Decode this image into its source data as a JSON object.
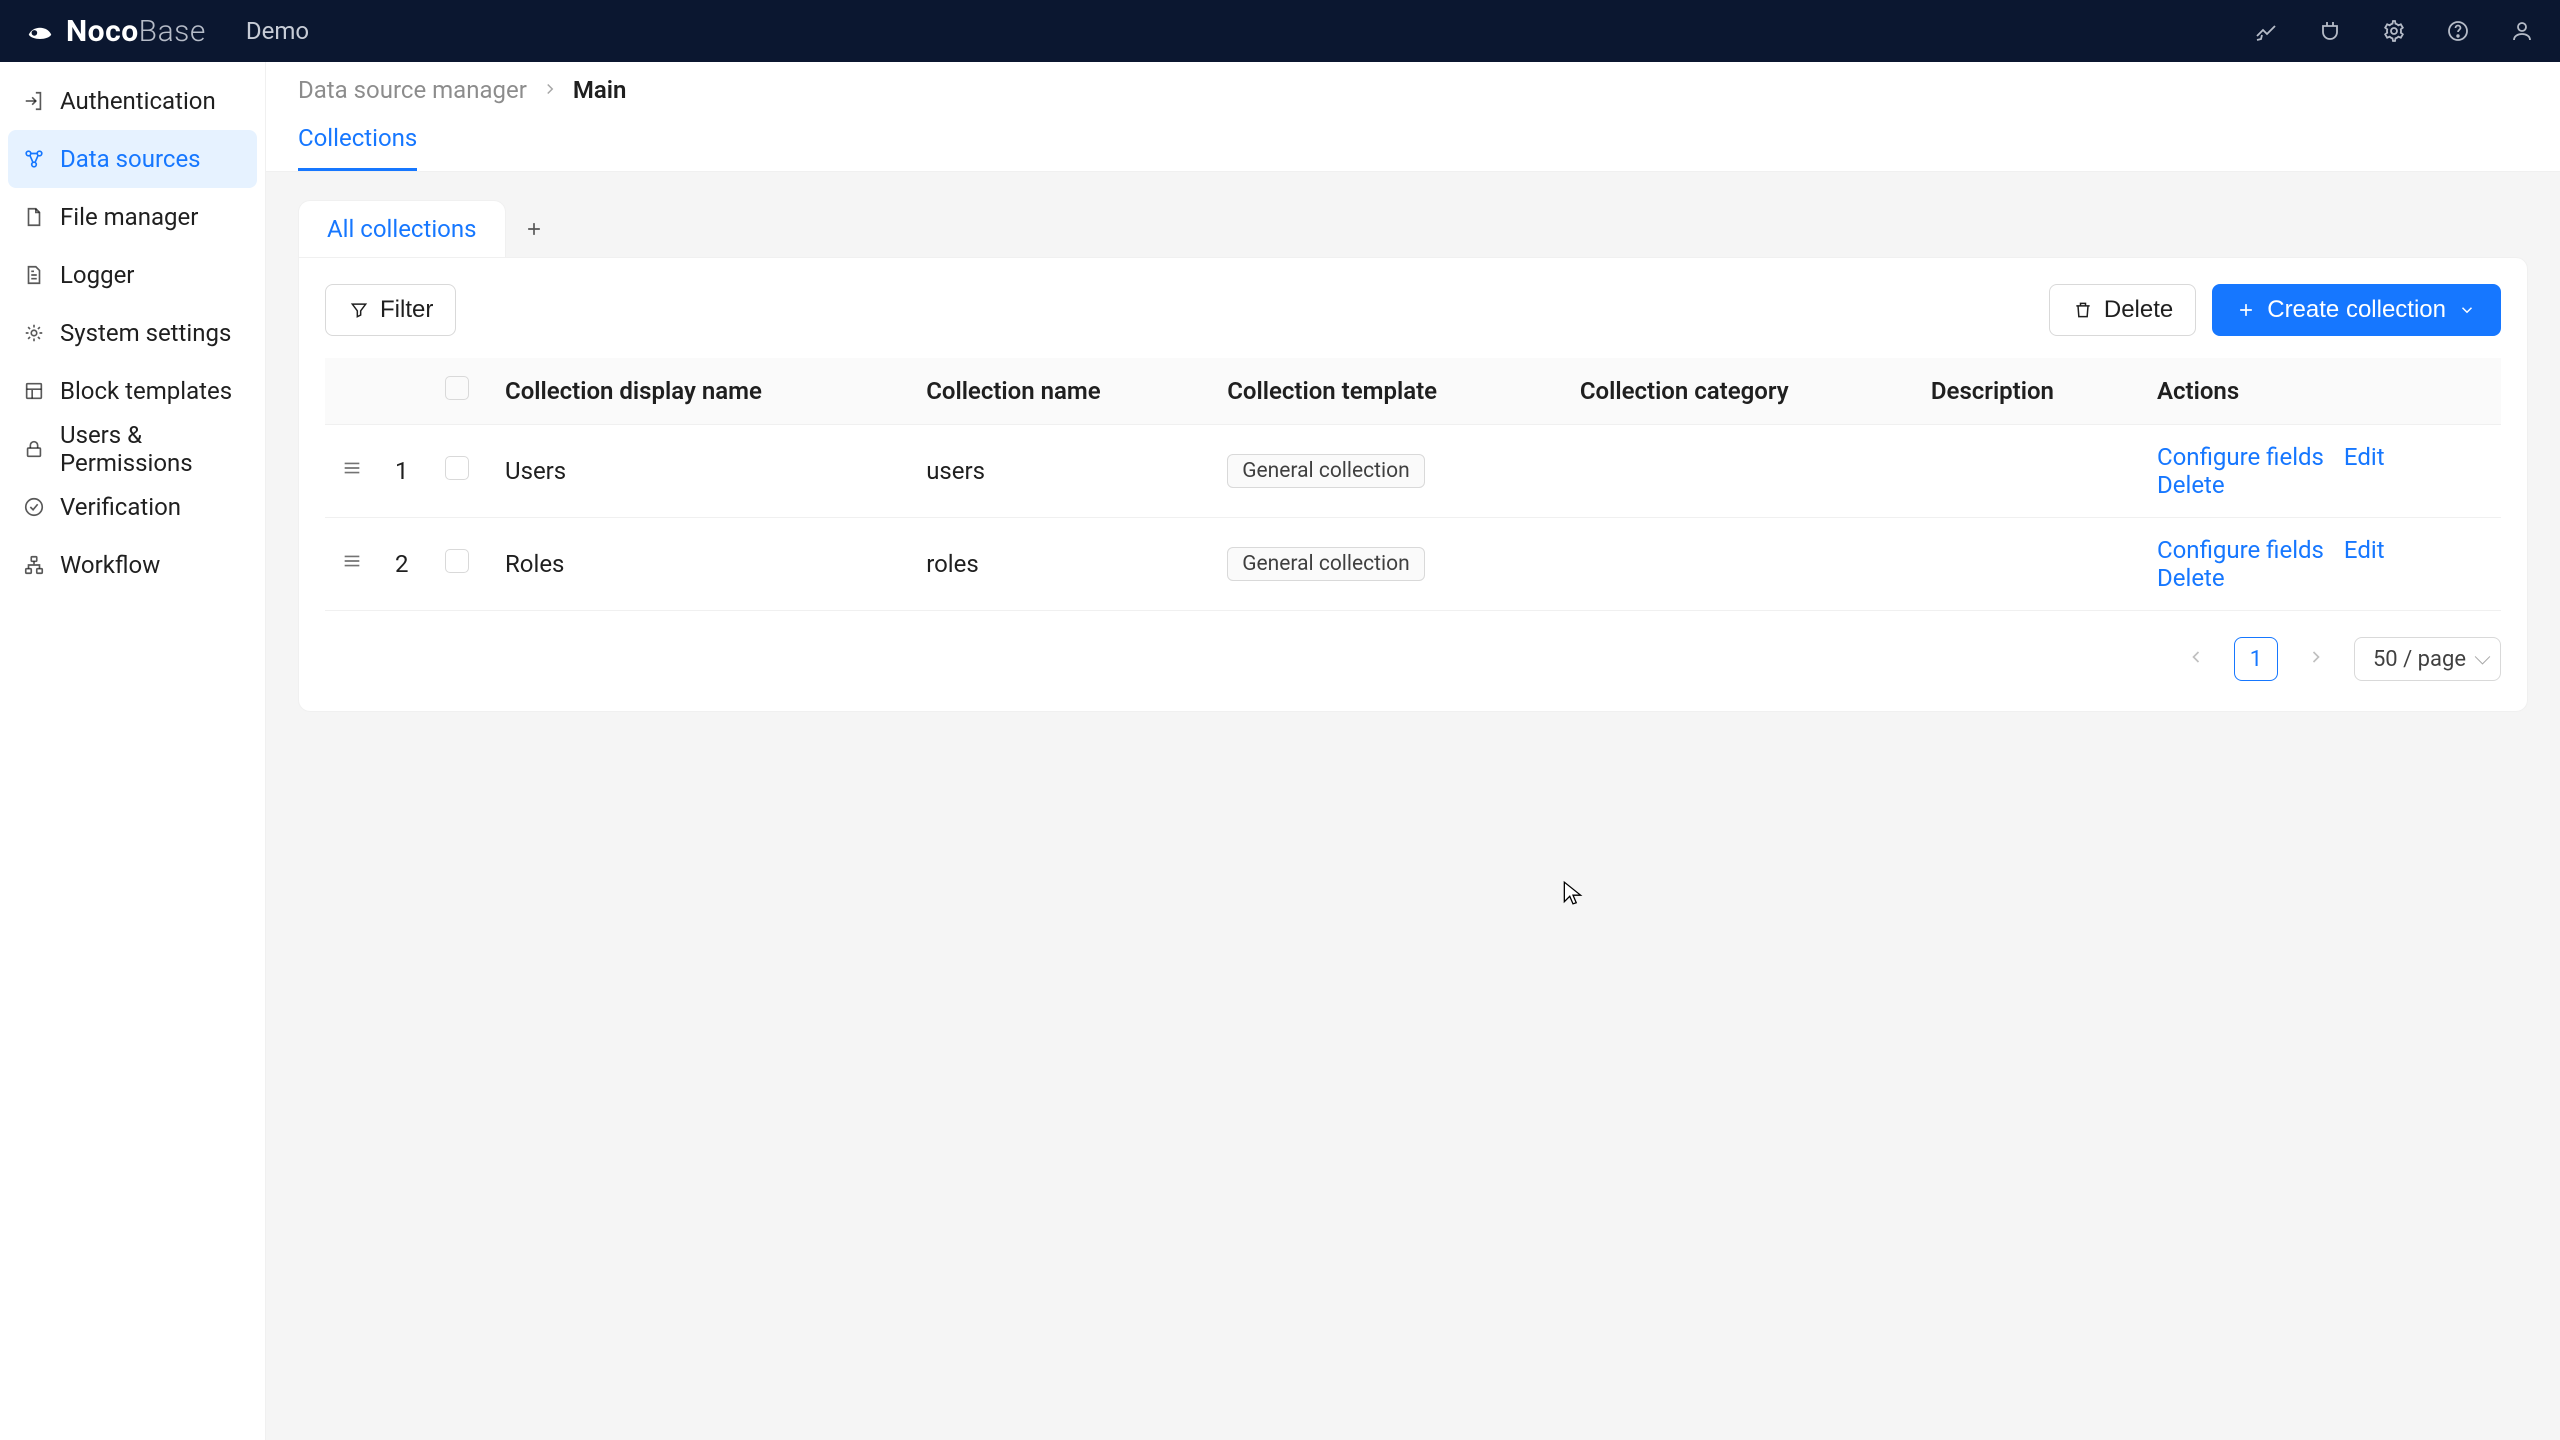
{
  "brand": {
    "name1": "Noco",
    "name2": "Base"
  },
  "header": {
    "menu": "Demo"
  },
  "sidebar": {
    "items": [
      {
        "label": "Authentication"
      },
      {
        "label": "Data sources"
      },
      {
        "label": "File manager"
      },
      {
        "label": "Logger"
      },
      {
        "label": "System settings"
      },
      {
        "label": "Block templates"
      },
      {
        "label": "Users & Permissions"
      },
      {
        "label": "Verification"
      },
      {
        "label": "Workflow"
      }
    ]
  },
  "breadcrumb": {
    "parent": "Data source manager",
    "current": "Main"
  },
  "innerTab": "Collections",
  "cardTab": "All collections",
  "toolbar": {
    "filter": "Filter",
    "delete": "Delete",
    "create": "Create collection"
  },
  "table": {
    "headers": {
      "display": "Collection display name",
      "name": "Collection name",
      "template": "Collection template",
      "category": "Collection category",
      "description": "Description",
      "actions": "Actions"
    },
    "rows": [
      {
        "idx": "1",
        "display": "Users",
        "name": "users",
        "template": "General collection"
      },
      {
        "idx": "2",
        "display": "Roles",
        "name": "roles",
        "template": "General collection"
      }
    ],
    "actions": {
      "configure": "Configure fields",
      "edit": "Edit",
      "delete": "Delete"
    }
  },
  "pager": {
    "page": "1",
    "size": "50 / page"
  }
}
